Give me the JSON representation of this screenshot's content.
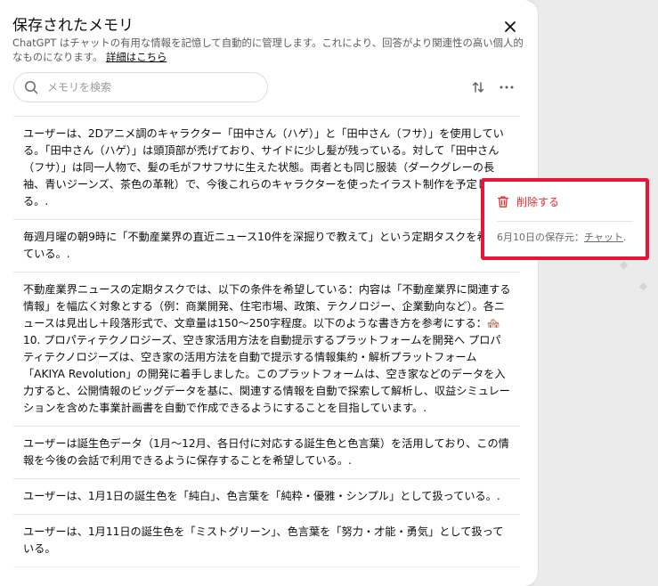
{
  "dialog": {
    "title": "保存されたメモリ",
    "description": "ChatGPT はチャットの有用な情報を記憶して自動的に管理します。これにより、回答がより関連性の高い個人的なものになります。",
    "details_link": "詳細はこちら",
    "icons": {
      "close": "close-icon",
      "search": "search-icon",
      "sort": "sort-icon",
      "more": "more-horizontal-icon",
      "delete": "trash-icon"
    }
  },
  "search": {
    "placeholder": "メモリを検索",
    "value": ""
  },
  "memories": [
    {
      "text": "ユーザーは、2Dアニメ調のキャラクター「田中さん（ハゲ）」と「田中さん（フサ）」を使用している。「田中さん（ハゲ）」は頭頂部が禿げており、サイドに少し髪が残っている。対して「田中さん（フサ）」は同一人物で、髪の毛がフサフサに生えた状態。両者とも同じ服装（ダークグレーの長袖、青いジーンズ、茶色の革靴）で、今後これらのキャラクターを使ったイラスト制作を予定している。."
    },
    {
      "text": "毎週月曜の朝9時に「不動産業界の直近ニュース10件を深掘りで教えて」という定期タスクを希望している。."
    },
    {
      "text": "不動産業界ニュースの定期タスクでは、以下の条件を希望している：内容は「不動産業界に関連する情報」を幅広く対象とする（例：商業開発、住宅市場、政策、テクノロジー、企業動向など）。各ニュースは見出し＋段落形式で、文章量は150〜250字程度。以下のような書き方を参考にする：🏘️ 10. プロパティテクノロジーズ、空き家活用方法を自動提示するプラットフォームを開発へ プロパティテクノロジーズは、空き家の活用方法を自動で提示する情報集約・解析プラットフォーム「AKIYA Revolution」の開発に着手しました。このプラットフォームは、空き家などのデータを入力すると、公開情報のビッグデータを基に、関連する情報を自動で探索して解析し、収益シミュレーションを含めた事業計画書を自動で作成できるようにすることを目指しています。."
    },
    {
      "text": "ユーザーは誕生色データ（1月〜12月、各日付に対応する誕生色と色言葉）を活用しており、この情報を今後の会話で利用できるように保存することを希望している。."
    },
    {
      "text": "ユーザーは、1月1日の誕生色を「純白」、色言葉を「純粋・優雅・シンプル」として扱っている。."
    },
    {
      "text": "ユーザーは、1月11日の誕生色を「ミストグリーン」、色言葉を「努力・才能・勇気」として扱っている。"
    }
  ],
  "popup": {
    "delete_label": "削除する",
    "source_prefix": "6月10日の保存元：",
    "source_link": "チャット",
    "source_suffix": ".",
    "delete_color": "#e02e2a",
    "highlight_color": "#e8143a"
  }
}
